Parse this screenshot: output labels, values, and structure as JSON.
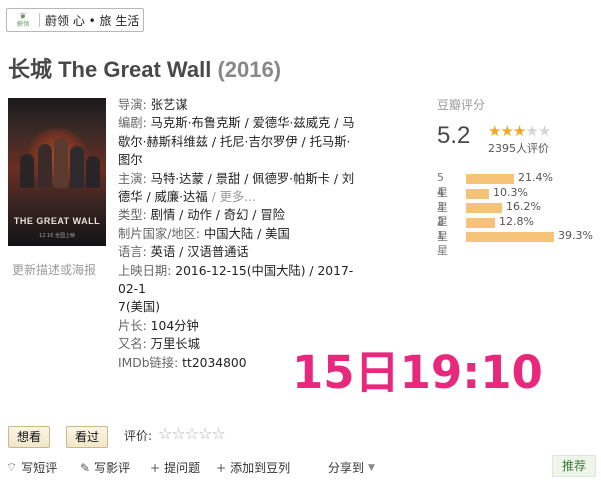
{
  "brand": {
    "logo_glyph": "❦",
    "logo_text": "蔚领",
    "name": "蔚领 心 • 旅 生活"
  },
  "movie": {
    "title": "长城 The Great Wall",
    "year": "(2016)"
  },
  "poster": {
    "title": "THE GREAT WALL",
    "caption": "12.16 全国上映"
  },
  "update_link": "更新描述或海报",
  "info": {
    "director_label": "导演:",
    "director": "张艺谋",
    "writer_label": "编剧:",
    "writers_line1": "马克斯·布鲁克斯 / 爱德华·兹威克 / 马",
    "writers_line2": "歇尔·赫斯科维兹 / 托尼·吉尔罗伊 / 托马斯·",
    "writers_line3": "图尔",
    "cast_label": "主演:",
    "cast_line1": "马特·达蒙 / 景甜 / 佩德罗·帕斯卡 / 刘",
    "cast_line2": "德华 / 威廉·达福",
    "cast_more": "/ 更多...",
    "genre_label": "类型:",
    "genre": "剧情 / 动作 / 奇幻 / 冒险",
    "country_label": "制片国家/地区:",
    "country": "中国大陆 / 美国",
    "language_label": "语言:",
    "language": "英语 / 汉语普通话",
    "release_label": "上映日期:",
    "release_line1": "2016-12-15(中国大陆) / 2017-02-1",
    "release_line2": "7(美国)",
    "runtime_label": "片长:",
    "runtime": "104分钟",
    "aka_label": "又名:",
    "aka": "万里长城",
    "imdb_label": "IMDb链接:",
    "imdb": "tt2034800"
  },
  "rating": {
    "label": "豆瓣评分",
    "score": "5.2",
    "stars_filled": 2.5,
    "stars_total": 5,
    "count_text": "2395人评价",
    "distribution": [
      {
        "star": "5星",
        "percent": "21.4%",
        "value": 21.4
      },
      {
        "star": "4星",
        "percent": "10.3%",
        "value": 10.3
      },
      {
        "star": "3星",
        "percent": "16.2%",
        "value": 16.2
      },
      {
        "star": "2星",
        "percent": "12.8%",
        "value": 12.8
      },
      {
        "star": "1星",
        "percent": "39.3%",
        "value": 39.3
      }
    ]
  },
  "overlay_time": "15日19:10",
  "actions": {
    "want": "想看",
    "seen": "看过",
    "rate_label": "评价:",
    "rate_stars": "☆☆☆☆☆"
  },
  "bottom_bar": {
    "short_review": "写短评",
    "review": "写影评",
    "question": "提问题",
    "add_list": "添加到豆列",
    "share": "分享到",
    "recommend": "推荐"
  },
  "colors": {
    "stamp": "#e8287c",
    "star": "#f5a623",
    "bar": "#f4c378",
    "recommend_text": "#3b7a3b"
  }
}
